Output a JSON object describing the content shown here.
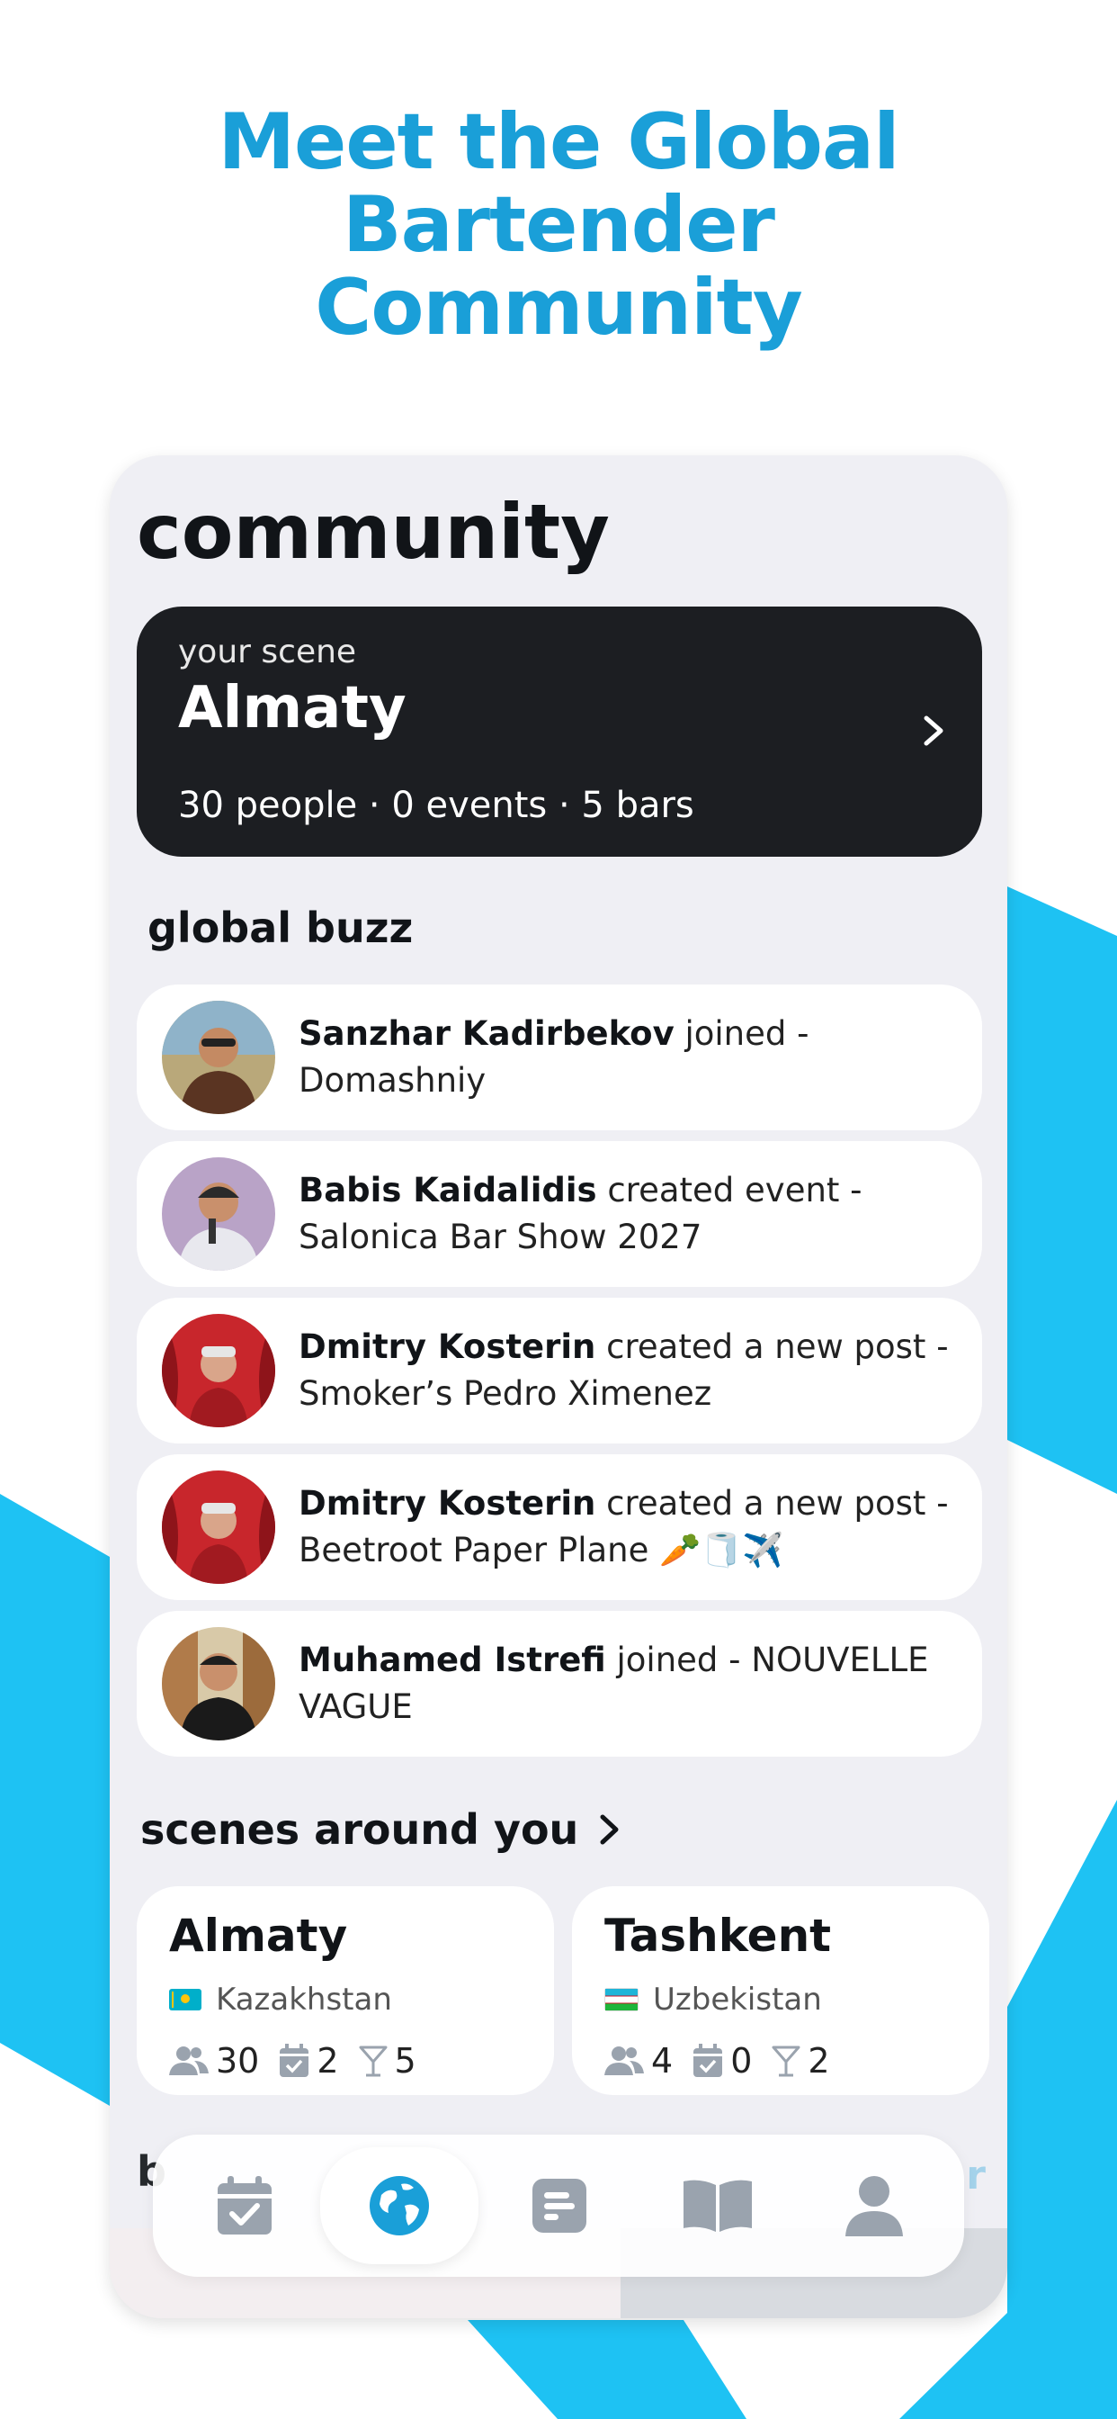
{
  "headline": {
    "lines": [
      "Meet the Global",
      "Bartender",
      "Community"
    ]
  },
  "page": {
    "title": "community"
  },
  "your_scene": {
    "label": "your scene",
    "city": "Almaty",
    "stats": "30 people · 0 events · 5 bars"
  },
  "global_buzz": {
    "title": "global buzz",
    "items": [
      {
        "name": "Sanzhar Kadirbekov",
        "action": " joined - Domashniy"
      },
      {
        "name": "Babis Kaidalidis",
        "action": " created event - Salonica Bar Show 2027"
      },
      {
        "name": "Dmitry Kosterin",
        "action": " created a new post - Smoker’s Pedro Ximenez"
      },
      {
        "name": "Dmitry Kosterin",
        "action": " created a new post - Beetroot Paper Plane 🥕🧻✈️"
      },
      {
        "name": "Muhamed Istrefi",
        "action": " joined - NOUVELLE VAGUE"
      }
    ]
  },
  "scenes_around": {
    "title": "scenes around you",
    "items": [
      {
        "city": "Almaty",
        "country": "Kazakhstan",
        "people": "30",
        "events": "2",
        "bars": "5"
      },
      {
        "city": "Tashkent",
        "country": "Uzbekistan",
        "people": "4",
        "events": "0",
        "bars": "2"
      }
    ]
  },
  "peek": {
    "left": "b",
    "right": "r"
  },
  "nav": {
    "items": [
      "calendar-icon",
      "globe-icon",
      "feed-icon",
      "book-icon",
      "profile-icon"
    ],
    "active_index": 1
  },
  "colors": {
    "accent": "#1a9fd8",
    "blue_shape": "#1ec2f3",
    "dark_card": "#1c1e22",
    "screen_bg": "#efeff4",
    "icon_gray": "#9aa3ae"
  }
}
